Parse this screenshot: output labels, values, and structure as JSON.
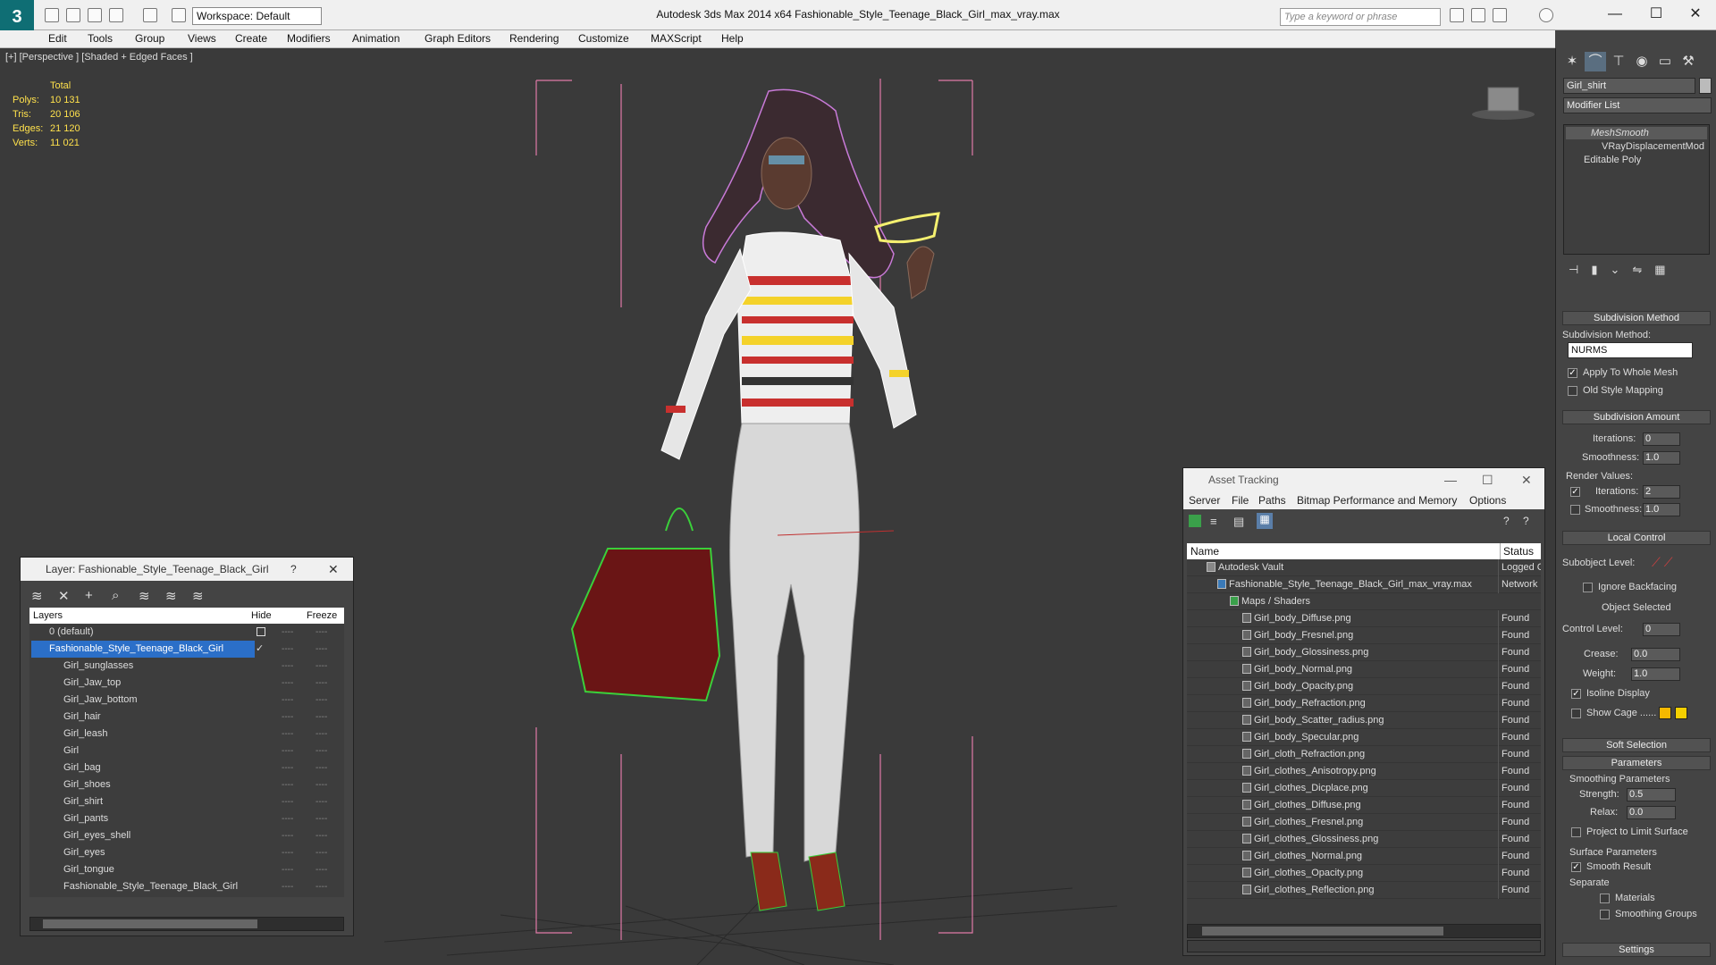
{
  "titlebar": {
    "workspace": "Workspace: Default",
    "app_title": "Autodesk 3ds Max  2014 x64      Fashionable_Style_Teenage_Black_Girl_max_vray.max",
    "search_placeholder": "Type a keyword or phrase"
  },
  "menu": [
    "Edit",
    "Tools",
    "Group",
    "Views",
    "Create",
    "Modifiers",
    "Animation",
    "Graph Editors",
    "Rendering",
    "Customize",
    "MAXScript",
    "Help"
  ],
  "viewport": {
    "label": "[+] [Perspective ] [Shaded + Edged Faces ]",
    "stats": {
      "header": "Total",
      "rows": [
        {
          "label": "Polys:",
          "value": "10 131"
        },
        {
          "label": "Tris:",
          "value": "20 106"
        },
        {
          "label": "Edges:",
          "value": "21 120"
        },
        {
          "label": "Verts:",
          "value": "11 021"
        }
      ]
    }
  },
  "command_panel": {
    "object_name": "Girl_shirt",
    "modifier_list": "Modifier List",
    "stack": [
      "MeshSmooth",
      "VRayDisplacementMod",
      "Editable Poly"
    ],
    "subdivision_method_head": "Subdivision Method",
    "subdivision_method_label": "Subdivision Method:",
    "subdivision_method_value": "NURMS",
    "apply_whole_mesh": "Apply To Whole Mesh",
    "old_style_mapping": "Old Style Mapping",
    "subdivision_amount_head": "Subdivision Amount",
    "iterations_label": "Iterations:",
    "iterations_value": "0",
    "smoothness_label": "Smoothness:",
    "smoothness_value": "1.0",
    "render_values_label": "Render Values:",
    "render_iterations_label": "Iterations:",
    "render_iterations_value": "2",
    "render_smoothness_label": "Smoothness:",
    "render_smoothness_value": "1.0",
    "local_control_head": "Local Control",
    "subobject_level_label": "Subobject Level:",
    "ignore_backfacing": "Ignore Backfacing",
    "object_selected": "Object Selected",
    "control_level_label": "Control Level:",
    "control_level_value": "0",
    "crease_label": "Crease:",
    "crease_value": "0.0",
    "weight_label": "Weight:",
    "weight_value": "1.0",
    "isoline_display": "Isoline Display",
    "show_cage": "Show Cage ......",
    "soft_selection_head": "Soft Selection",
    "parameters_head": "Parameters",
    "smoothing_parameters": "Smoothing Parameters",
    "strength_label": "Strength:",
    "strength_value": "0.5",
    "relax_label": "Relax:",
    "relax_value": "0.0",
    "project_limit": "Project to Limit Surface",
    "surface_parameters": "Surface Parameters",
    "smooth_result": "Smooth Result",
    "separate_label": "Separate",
    "materials": "Materials",
    "smoothing_groups": "Smoothing Groups",
    "settings_head": "Settings",
    "accent_color": "#f5b800"
  },
  "layer_window": {
    "title": "Layer: Fashionable_Style_Teenage_Black_Girl",
    "help": "?",
    "columns": {
      "layers": "Layers",
      "hide": "Hide",
      "freeze": "Freeze"
    },
    "rows": [
      "0 (default)",
      "Fashionable_Style_Teenage_Black_Girl",
      "Girl_sunglasses",
      "Girl_Jaw_top",
      "Girl_Jaw_bottom",
      "Girl_hair",
      "Girl_leash",
      "Girl",
      "Girl_bag",
      "Girl_shoes",
      "Girl_shirt",
      "Girl_pants",
      "Girl_eyes_shell",
      "Girl_eyes",
      "Girl_tongue",
      "Fashionable_Style_Teenage_Black_Girl"
    ],
    "dash": "----"
  },
  "asset_window": {
    "title": "Asset Tracking",
    "menu": [
      "Server",
      "File",
      "Paths",
      "Bitmap Performance and Memory",
      "Options"
    ],
    "columns": {
      "name": "Name",
      "status": "Status"
    },
    "rows": [
      {
        "name": "Autodesk Vault",
        "status": "Logged C"
      },
      {
        "name": "Fashionable_Style_Teenage_Black_Girl_max_vray.max",
        "status": "Network I"
      },
      {
        "name": "Maps / Shaders",
        "status": ""
      },
      {
        "name": "Girl_body_Diffuse.png",
        "status": "Found"
      },
      {
        "name": "Girl_body_Fresnel.png",
        "status": "Found"
      },
      {
        "name": "Girl_body_Glossiness.png",
        "status": "Found"
      },
      {
        "name": "Girl_body_Normal.png",
        "status": "Found"
      },
      {
        "name": "Girl_body_Opacity.png",
        "status": "Found"
      },
      {
        "name": "Girl_body_Refraction.png",
        "status": "Found"
      },
      {
        "name": "Girl_body_Scatter_radius.png",
        "status": "Found"
      },
      {
        "name": "Girl_body_Specular.png",
        "status": "Found"
      },
      {
        "name": "Girl_cloth_Refraction.png",
        "status": "Found"
      },
      {
        "name": "Girl_clothes_Anisotropy.png",
        "status": "Found"
      },
      {
        "name": "Girl_clothes_Dicplace.png",
        "status": "Found"
      },
      {
        "name": "Girl_clothes_Diffuse.png",
        "status": "Found"
      },
      {
        "name": "Girl_clothes_Fresnel.png",
        "status": "Found"
      },
      {
        "name": "Girl_clothes_Glossiness.png",
        "status": "Found"
      },
      {
        "name": "Girl_clothes_Normal.png",
        "status": "Found"
      },
      {
        "name": "Girl_clothes_Opacity.png",
        "status": "Found"
      },
      {
        "name": "Girl_clothes_Reflection.png",
        "status": "Found"
      }
    ]
  }
}
